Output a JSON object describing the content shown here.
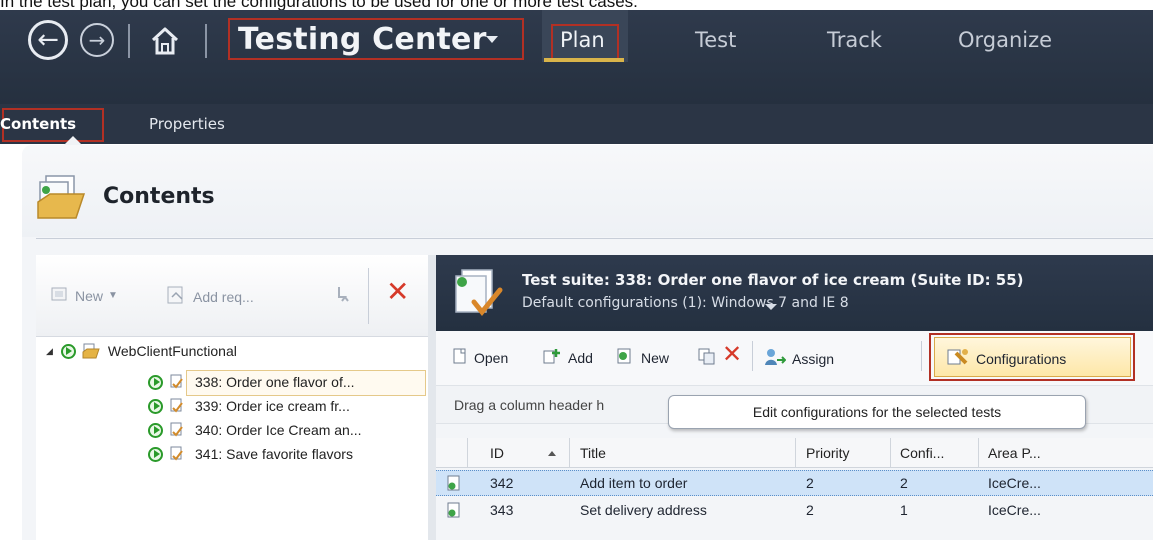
{
  "caption": "In the test plan, you can set the configurations to be used for one or more test cases.",
  "app": {
    "title": "Testing Center",
    "nav": [
      "Plan",
      "Test",
      "Track",
      "Organize"
    ]
  },
  "subnav": {
    "contents": "Contents",
    "properties": "Properties"
  },
  "panel": {
    "title": "Contents"
  },
  "left_toolbar": {
    "new": "New",
    "add_req": "Add req..."
  },
  "tree": {
    "root": "WebClientFunctional",
    "items": [
      "338: Order one flavor of...",
      "339: Order ice cream fr...",
      "340: Order Ice Cream an...",
      "341: Save favorite flavors"
    ]
  },
  "suite": {
    "title": "Test suite: 338: Order one flavor of ice cream (Suite ID: 55)",
    "default_configs": "Default configurations (1):  Windows 7 and IE 8"
  },
  "right_toolbar": {
    "open": "Open",
    "add": "Add",
    "new": "New",
    "assign": "Assign",
    "configurations": "Configurations"
  },
  "drag_hint": "Drag a column header h",
  "tooltip": "Edit configurations for the selected tests",
  "grid": {
    "columns": [
      "ID",
      "Title",
      "Priority",
      "Confi...",
      "Area P..."
    ],
    "rows": [
      {
        "id": "342",
        "title": "Add item to order",
        "priority": "2",
        "config": "2",
        "area": "IceCre..."
      },
      {
        "id": "343",
        "title": "Set delivery address",
        "priority": "2",
        "config": "1",
        "area": "IceCre..."
      }
    ]
  },
  "colors": {
    "topbar": "#2f3a4c",
    "highlight_box": "#b23024",
    "plan_underline": "#d9b44a",
    "selected_row": "#cfe3f8",
    "delete_red": "#d63a2a"
  }
}
